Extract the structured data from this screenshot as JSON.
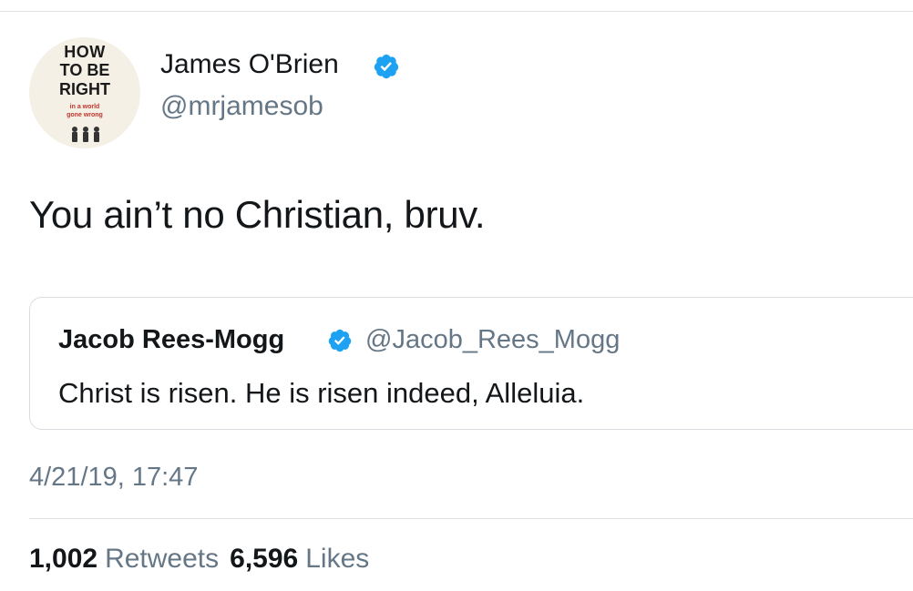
{
  "avatar": {
    "title_lines": [
      "HOW",
      "TO BE",
      "RIGHT"
    ],
    "subtitle_lines": [
      "in a world",
      "gone wrong"
    ],
    "icon": "book-cover-icon"
  },
  "author": {
    "display_name": "James O'Brien",
    "handle": "@mrjamesob",
    "verified_icon": "verified-badge-icon"
  },
  "tweet": {
    "text": "You ain’t no Christian, bruv."
  },
  "quoted_tweet": {
    "display_name": "Jacob Rees-Mogg",
    "handle": "@Jacob_Rees_Mogg",
    "text": "Christ is risen. He is risen indeed, Alleluia.",
    "verified_icon": "verified-badge-icon"
  },
  "meta": {
    "timestamp": "4/21/19, 17:47"
  },
  "stats": {
    "retweets_count": "1,002",
    "retweets_label": "Retweets",
    "likes_count": "6,596",
    "likes_label": "Likes"
  },
  "colors": {
    "verified_blue": "#1da1f2",
    "secondary_text": "#657786",
    "primary_text": "#14171a",
    "divider": "#dfe3e6"
  }
}
